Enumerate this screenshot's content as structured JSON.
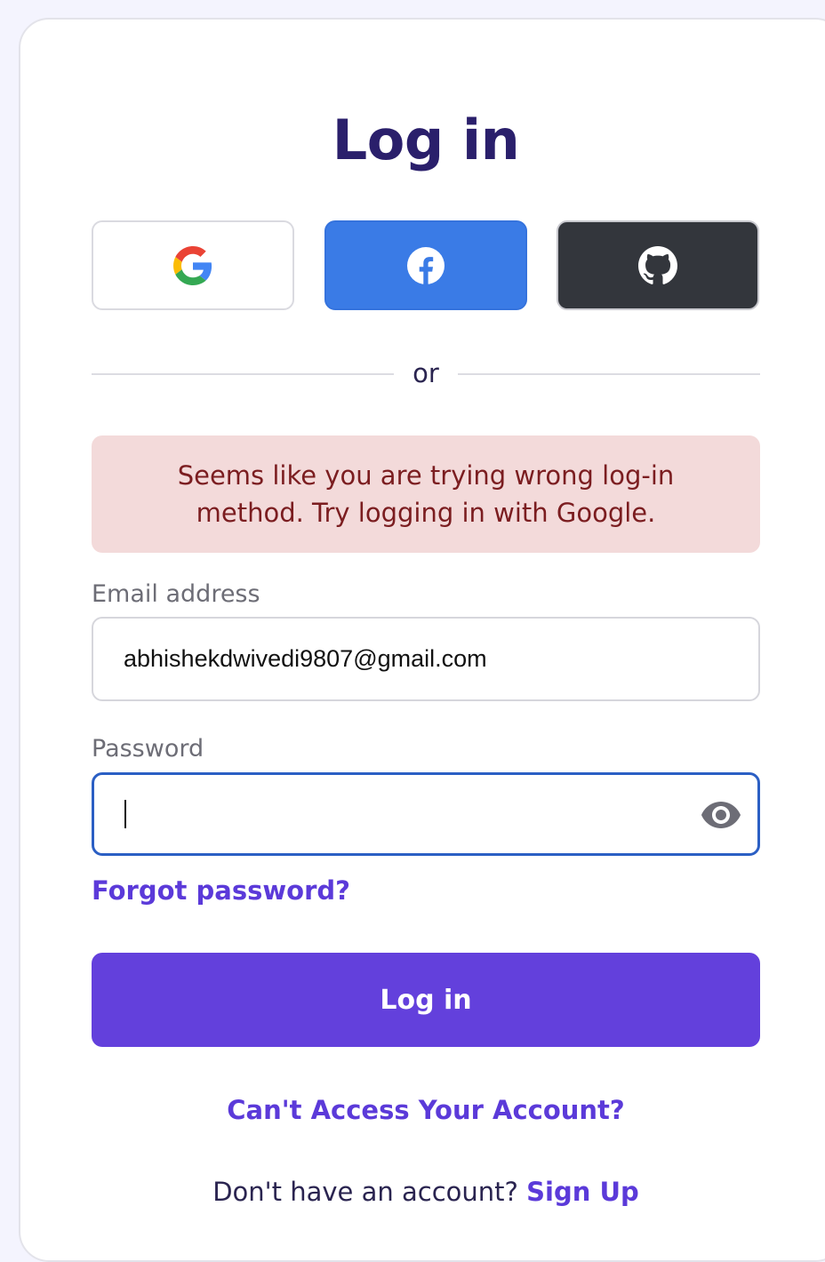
{
  "page": {
    "title": "Log in"
  },
  "social_buttons": {
    "google_icon": "google-icon",
    "facebook_icon": "facebook-icon",
    "github_icon": "github-icon",
    "colors": {
      "facebook": "#3a7be6",
      "github": "#33363c"
    }
  },
  "divider": {
    "text": "or"
  },
  "alert": {
    "message": "Seems like you are trying wrong log-in method. Try logging in with Google.",
    "background": "#f3dada",
    "text_color": "#7b1d20"
  },
  "form": {
    "email_label": "Email address",
    "email_value": "abhishekdwivedi9807@gmail.com",
    "password_label": "Password",
    "password_value": "",
    "password_toggle_icon": "eye-icon",
    "forgot_password": "Forgot password?",
    "submit_label": "Log in"
  },
  "footer": {
    "cant_access": "Can't Access Your Account?",
    "no_account_text": "Don't have an account?",
    "signup_link": "Sign Up"
  },
  "theme": {
    "accent": "#6340dc",
    "heading": "#2a1f6b",
    "focus_border": "#2b5fc4"
  }
}
